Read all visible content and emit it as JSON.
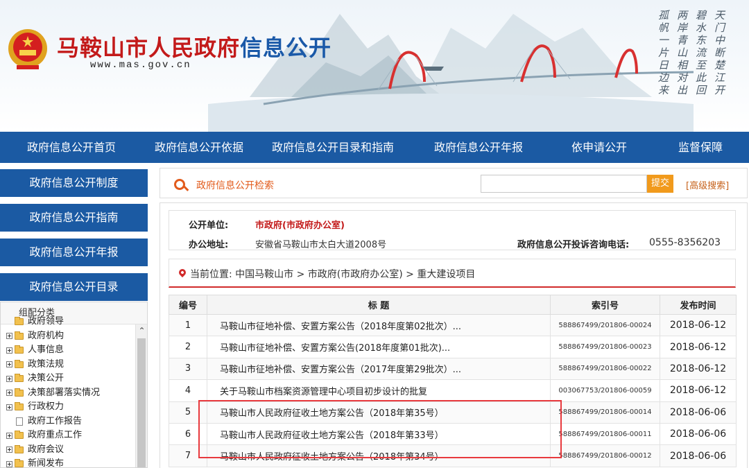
{
  "header": {
    "title_red": "马鞍山市人民政府",
    "title_blue": "信息公开",
    "url": "www.mas.gov.cn",
    "poem_columns": [
      "天门中断楚江开",
      "碧水东流至此回",
      "两岸青山相对出",
      "孤帆一片日边来"
    ]
  },
  "nav": {
    "items": [
      {
        "label": "政府信息公开首页"
      },
      {
        "label": "政府信息公开依据"
      },
      {
        "label": "政府信息公开目录和指南"
      },
      {
        "label": "政府信息公开年报"
      },
      {
        "label": "依申请公开"
      },
      {
        "label": "监督保障"
      }
    ]
  },
  "sidebar": {
    "buttons": [
      {
        "label": "政府信息公开制度"
      },
      {
        "label": "政府信息公开指南"
      },
      {
        "label": "政府信息公开年报"
      },
      {
        "label": "政府信息公开目录"
      }
    ],
    "panel_title": "组配分类",
    "tree": [
      {
        "label": "政府领导",
        "type": "folder"
      },
      {
        "label": "政府机构",
        "type": "folder"
      },
      {
        "label": "人事信息",
        "type": "folder"
      },
      {
        "label": "政策法规",
        "type": "folder"
      },
      {
        "label": "决策公开",
        "type": "folder"
      },
      {
        "label": "决策部署落实情况",
        "type": "folder"
      },
      {
        "label": "行政权力",
        "type": "folder"
      },
      {
        "label": "政府工作报告",
        "type": "doc"
      },
      {
        "label": "政府重点工作",
        "type": "folder"
      },
      {
        "label": "政府会议",
        "type": "folder"
      },
      {
        "label": "新闻发布",
        "type": "folder"
      }
    ]
  },
  "search": {
    "label": "政府信息公开检索",
    "submit_label": "提交",
    "advanced_label": "[高级搜索]"
  },
  "info": {
    "unit_key": "公开单位:",
    "unit_value": "市政府(市政府办公室)",
    "address_key": "办公地址:",
    "address_value": "安徽省马鞍山市太白大道2008号",
    "tel_key": "政府信息公开投诉咨询电话:",
    "tel_value": "0555-8356203"
  },
  "breadcrumb": {
    "text": "当前位置: 中国马鞍山市 > 市政府(市政府办公室) > 重大建设项目"
  },
  "table": {
    "headers": [
      "编号",
      "标 题",
      "索引号",
      "发布时间"
    ],
    "rows": [
      {
        "no": "1",
        "title": "马鞍山市征地补偿、安置方案公告（2018年度第02批次）...",
        "index": "588867499/201806-00024",
        "date": "2018-06-12"
      },
      {
        "no": "2",
        "title": "马鞍山市征地补偿、安置方案公告(2018年度第01批次)...",
        "index": "588867499/201806-00023",
        "date": "2018-06-12"
      },
      {
        "no": "3",
        "title": "马鞍山市征地补偿、安置方案公告（2017年度第29批次）...",
        "index": "588867499/201806-00022",
        "date": "2018-06-12"
      },
      {
        "no": "4",
        "title": "关于马鞍山市档案资源管理中心项目初步设计的批复",
        "index": "003067753/201806-00059",
        "date": "2018-06-12"
      },
      {
        "no": "5",
        "title": "马鞍山市人民政府征收土地方案公告（2018年第35号）",
        "index": "588867499/201806-00014",
        "date": "2018-06-06"
      },
      {
        "no": "6",
        "title": "马鞍山市人民政府征收土地方案公告（2018年第33号）",
        "index": "588867499/201806-00011",
        "date": "2018-06-06"
      },
      {
        "no": "7",
        "title": "马鞍山市人民政府征收土地方案公告（2018年第34号）",
        "index": "588867499/201806-00012",
        "date": "2018-06-06"
      }
    ]
  },
  "colors": {
    "nav_blue": "#1b5aa3",
    "title_red": "#c31a1a",
    "accent_orange": "#e25b1c",
    "highlight_red": "#e8393d"
  }
}
